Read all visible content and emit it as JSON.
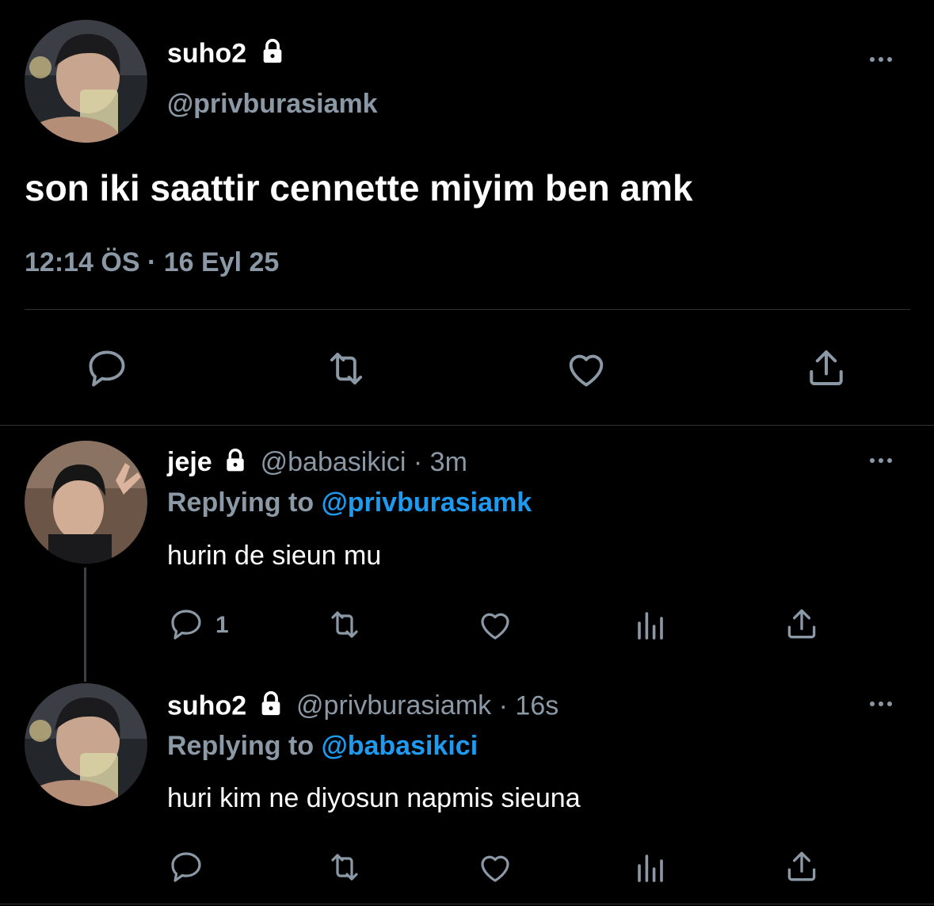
{
  "main_tweet": {
    "display_name": "suho2",
    "handle": "@privburasiamk",
    "text": "son iki saattir cennette miyim ben amk",
    "time": "12:14 ÖS",
    "separator": "·",
    "date": "16 Eyl 25",
    "actions": [
      "reply-icon",
      "retweet-icon",
      "like-icon",
      "share-icon"
    ]
  },
  "replies": [
    {
      "display_name": "jeje",
      "handle": "@babasikici",
      "separator": "·",
      "time": "3m",
      "replying_prefix": "Replying to",
      "replying_to": "@privburasiamk",
      "text": "hurin de sieun mu",
      "reply_count": "1"
    },
    {
      "display_name": "suho2",
      "handle": "@privburasiamk",
      "separator": "·",
      "time": "16s",
      "replying_prefix": "Replying to",
      "replying_to": "@babasikici",
      "text": "huri kim ne diyosun napmis sieuna",
      "reply_count": ""
    }
  ],
  "colors": {
    "background": "#000000",
    "primary_text": "#ffffff",
    "secondary_text": "#8b98a5",
    "link": "#1d9bf0",
    "divider": "#2f3336"
  }
}
